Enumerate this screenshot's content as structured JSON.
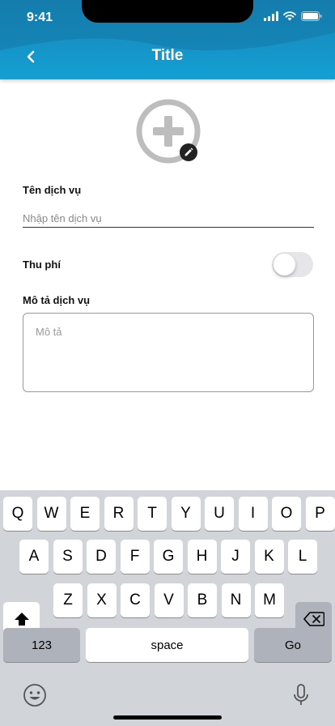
{
  "status_bar": {
    "time": "9:41"
  },
  "header": {
    "title": "Title",
    "colors": {
      "top": "#1583b5",
      "bottom": "#14a0d4"
    }
  },
  "form": {
    "service_name": {
      "label": "Tên dịch vụ",
      "placeholder": "Nhập tên dịch vụ",
      "value": ""
    },
    "fee": {
      "label": "Thu phí",
      "enabled": false
    },
    "description": {
      "label": "Mô tả dịch vụ",
      "placeholder": "Mô tả",
      "value": ""
    }
  },
  "keyboard": {
    "row1": [
      "Q",
      "W",
      "E",
      "R",
      "T",
      "Y",
      "U",
      "I",
      "O",
      "P"
    ],
    "row2": [
      "A",
      "S",
      "D",
      "F",
      "G",
      "H",
      "J",
      "K",
      "L"
    ],
    "row3": [
      "Z",
      "X",
      "C",
      "V",
      "B",
      "N",
      "M"
    ],
    "numbers_label": "123",
    "space_label": "space",
    "go_label": "Go"
  }
}
